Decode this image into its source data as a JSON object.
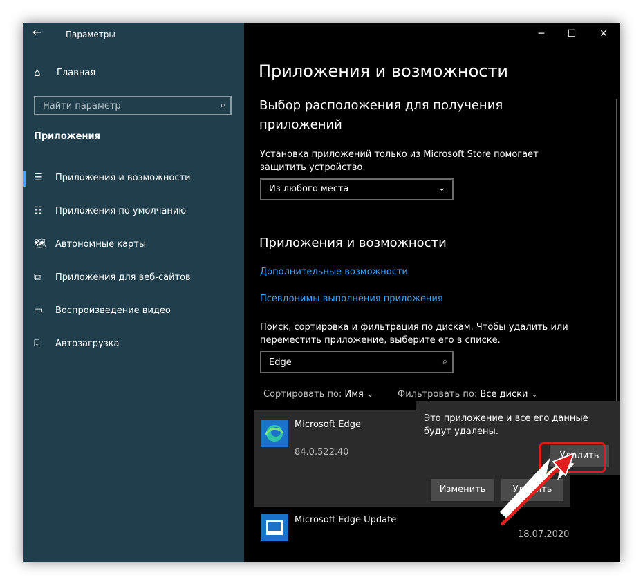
{
  "window": {
    "title": "Параметры",
    "minimize": "─",
    "maximize": "☐",
    "close": "✕"
  },
  "sidebar": {
    "back_icon": "←",
    "home_icon": "⌂",
    "home_label": "Главная",
    "search_placeholder": "Найти параметр",
    "search_icon": "⌕",
    "section": "Приложения",
    "items": [
      {
        "label": "Приложения и возможности",
        "icon": "☰"
      },
      {
        "label": "Приложения по умолчанию",
        "icon": "☷"
      },
      {
        "label": "Автономные карты",
        "icon": "🗺"
      },
      {
        "label": "Приложения для веб-сайтов",
        "icon": "⧉"
      },
      {
        "label": "Воспроизведение видео",
        "icon": "▭"
      },
      {
        "label": "Автозагрузка",
        "icon": "⍗"
      }
    ]
  },
  "main": {
    "title": "Приложения и возможности",
    "choose_location": {
      "heading": "Выбор расположения для получения приложений",
      "description": "Установка приложений только из Microsoft Store помогает защитить устройство.",
      "dropdown_value": "Из любого места",
      "dropdown_icon": "⌄"
    },
    "apps_section": {
      "heading": "Приложения и возможности",
      "link_optional": "Дополнительные возможности",
      "link_aliases": "Псевдонимы выполнения приложения",
      "search_description": "Поиск, сортировка и фильтрация по дискам. Чтобы удалить или переместить приложение, выберите его в списке.",
      "search_value": "Edge",
      "sort_label": "Сортировать по:",
      "sort_value": "Имя",
      "filter_label": "Фильтровать по:",
      "filter_value": "Все диски"
    },
    "apps": [
      {
        "name": "Microsoft Edge",
        "version": "84.0.522.40",
        "modify_label": "Изменить",
        "uninstall_label": "Удалить"
      },
      {
        "name": "Microsoft Edge Update",
        "date": "18.07.2020"
      }
    ]
  },
  "popup": {
    "message": "Это приложение и все его данные будут удалены.",
    "button_label": "Удалить"
  },
  "colors": {
    "sidebar_bg": "#203e4c",
    "accent": "#4aa3ff",
    "link": "#3fa6ff",
    "highlight": "#e01e1e"
  }
}
